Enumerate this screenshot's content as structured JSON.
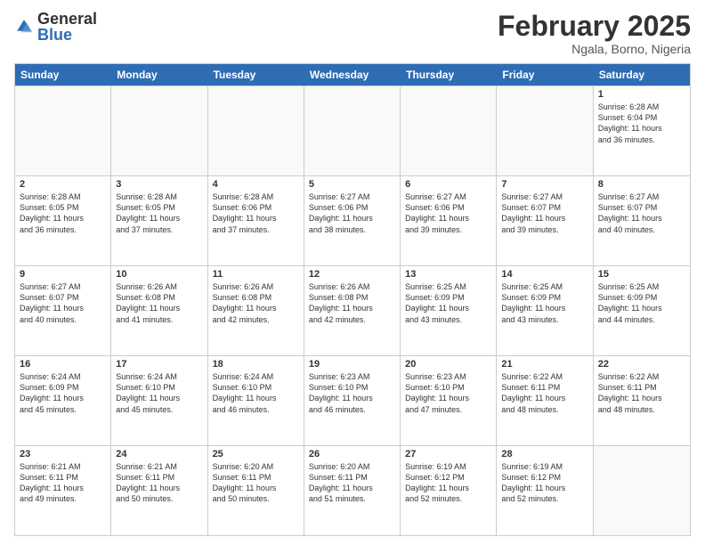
{
  "logo": {
    "general": "General",
    "blue": "Blue"
  },
  "header": {
    "month": "February 2025",
    "location": "Ngala, Borno, Nigeria"
  },
  "weekdays": [
    "Sunday",
    "Monday",
    "Tuesday",
    "Wednesday",
    "Thursday",
    "Friday",
    "Saturday"
  ],
  "weeks": [
    [
      {
        "day": "",
        "info": ""
      },
      {
        "day": "",
        "info": ""
      },
      {
        "day": "",
        "info": ""
      },
      {
        "day": "",
        "info": ""
      },
      {
        "day": "",
        "info": ""
      },
      {
        "day": "",
        "info": ""
      },
      {
        "day": "1",
        "info": "Sunrise: 6:28 AM\nSunset: 6:04 PM\nDaylight: 11 hours\nand 36 minutes."
      }
    ],
    [
      {
        "day": "2",
        "info": "Sunrise: 6:28 AM\nSunset: 6:05 PM\nDaylight: 11 hours\nand 36 minutes."
      },
      {
        "day": "3",
        "info": "Sunrise: 6:28 AM\nSunset: 6:05 PM\nDaylight: 11 hours\nand 37 minutes."
      },
      {
        "day": "4",
        "info": "Sunrise: 6:28 AM\nSunset: 6:06 PM\nDaylight: 11 hours\nand 37 minutes."
      },
      {
        "day": "5",
        "info": "Sunrise: 6:27 AM\nSunset: 6:06 PM\nDaylight: 11 hours\nand 38 minutes."
      },
      {
        "day": "6",
        "info": "Sunrise: 6:27 AM\nSunset: 6:06 PM\nDaylight: 11 hours\nand 39 minutes."
      },
      {
        "day": "7",
        "info": "Sunrise: 6:27 AM\nSunset: 6:07 PM\nDaylight: 11 hours\nand 39 minutes."
      },
      {
        "day": "8",
        "info": "Sunrise: 6:27 AM\nSunset: 6:07 PM\nDaylight: 11 hours\nand 40 minutes."
      }
    ],
    [
      {
        "day": "9",
        "info": "Sunrise: 6:27 AM\nSunset: 6:07 PM\nDaylight: 11 hours\nand 40 minutes."
      },
      {
        "day": "10",
        "info": "Sunrise: 6:26 AM\nSunset: 6:08 PM\nDaylight: 11 hours\nand 41 minutes."
      },
      {
        "day": "11",
        "info": "Sunrise: 6:26 AM\nSunset: 6:08 PM\nDaylight: 11 hours\nand 42 minutes."
      },
      {
        "day": "12",
        "info": "Sunrise: 6:26 AM\nSunset: 6:08 PM\nDaylight: 11 hours\nand 42 minutes."
      },
      {
        "day": "13",
        "info": "Sunrise: 6:25 AM\nSunset: 6:09 PM\nDaylight: 11 hours\nand 43 minutes."
      },
      {
        "day": "14",
        "info": "Sunrise: 6:25 AM\nSunset: 6:09 PM\nDaylight: 11 hours\nand 43 minutes."
      },
      {
        "day": "15",
        "info": "Sunrise: 6:25 AM\nSunset: 6:09 PM\nDaylight: 11 hours\nand 44 minutes."
      }
    ],
    [
      {
        "day": "16",
        "info": "Sunrise: 6:24 AM\nSunset: 6:09 PM\nDaylight: 11 hours\nand 45 minutes."
      },
      {
        "day": "17",
        "info": "Sunrise: 6:24 AM\nSunset: 6:10 PM\nDaylight: 11 hours\nand 45 minutes."
      },
      {
        "day": "18",
        "info": "Sunrise: 6:24 AM\nSunset: 6:10 PM\nDaylight: 11 hours\nand 46 minutes."
      },
      {
        "day": "19",
        "info": "Sunrise: 6:23 AM\nSunset: 6:10 PM\nDaylight: 11 hours\nand 46 minutes."
      },
      {
        "day": "20",
        "info": "Sunrise: 6:23 AM\nSunset: 6:10 PM\nDaylight: 11 hours\nand 47 minutes."
      },
      {
        "day": "21",
        "info": "Sunrise: 6:22 AM\nSunset: 6:11 PM\nDaylight: 11 hours\nand 48 minutes."
      },
      {
        "day": "22",
        "info": "Sunrise: 6:22 AM\nSunset: 6:11 PM\nDaylight: 11 hours\nand 48 minutes."
      }
    ],
    [
      {
        "day": "23",
        "info": "Sunrise: 6:21 AM\nSunset: 6:11 PM\nDaylight: 11 hours\nand 49 minutes."
      },
      {
        "day": "24",
        "info": "Sunrise: 6:21 AM\nSunset: 6:11 PM\nDaylight: 11 hours\nand 50 minutes."
      },
      {
        "day": "25",
        "info": "Sunrise: 6:20 AM\nSunset: 6:11 PM\nDaylight: 11 hours\nand 50 minutes."
      },
      {
        "day": "26",
        "info": "Sunrise: 6:20 AM\nSunset: 6:11 PM\nDaylight: 11 hours\nand 51 minutes."
      },
      {
        "day": "27",
        "info": "Sunrise: 6:19 AM\nSunset: 6:12 PM\nDaylight: 11 hours\nand 52 minutes."
      },
      {
        "day": "28",
        "info": "Sunrise: 6:19 AM\nSunset: 6:12 PM\nDaylight: 11 hours\nand 52 minutes."
      },
      {
        "day": "",
        "info": ""
      }
    ]
  ]
}
